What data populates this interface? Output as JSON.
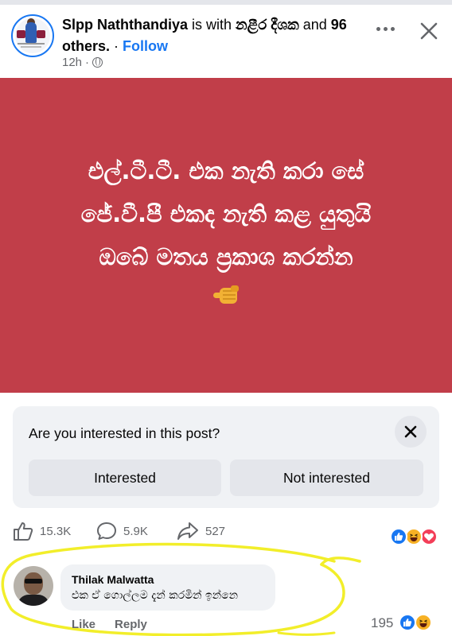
{
  "post": {
    "author": "Slpp Naththandiya",
    "with_text": " is with ",
    "tagged": "නළීර දීශක",
    "and_text": " and ",
    "others_count": "96",
    "others_word": "others.",
    "separator": " · ",
    "follow_label": "Follow",
    "time": "12h",
    "audience_icon": "globe-icon"
  },
  "image_text": {
    "line1": "එල්.ටී.ටී. එක නැති කරා සේ",
    "line2": "ජේ.වී.පී එකද නැති කළ යුතුයි",
    "line3": "ඔබේ මතය ප්‍රකාශ කරන්න",
    "emoji": "pointing-fist-icon",
    "background_color": "#c13e49"
  },
  "interest": {
    "question": "Are you interested in this post?",
    "interested_label": "Interested",
    "not_interested_label": "Not interested"
  },
  "actions": {
    "likes": "15.3K",
    "comments": "5.9K",
    "shares": "527",
    "reaction_icons": [
      "like-icon",
      "haha-icon",
      "love-icon"
    ]
  },
  "comment": {
    "author": "Thilak Malwatta",
    "text": "එක ඒ ගොල්ලම දැන් කරමින් ඉන්නෙ",
    "like_label": "Like",
    "reply_label": "Reply",
    "reaction_count": "195",
    "reaction_icons": [
      "like-icon",
      "haha-icon"
    ]
  },
  "colors": {
    "accent": "#1877f2",
    "highlight": "#f2ee2a"
  }
}
